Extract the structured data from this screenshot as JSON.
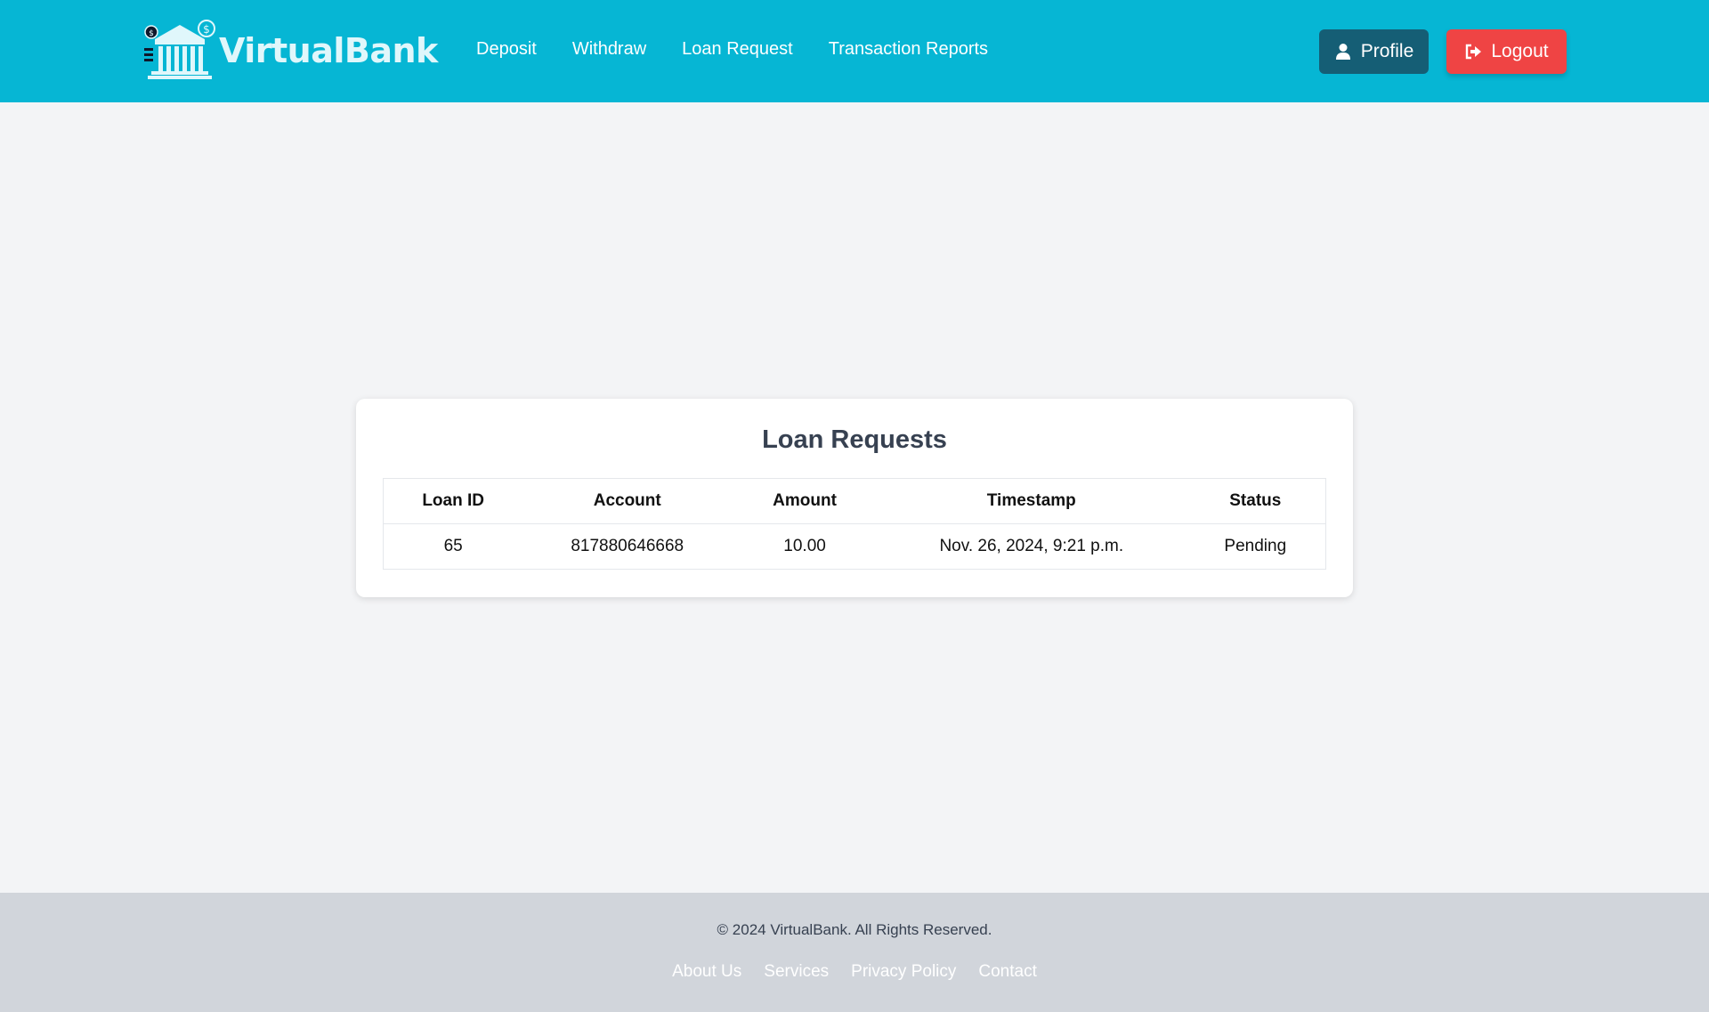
{
  "brand": {
    "name": "VirtualBank",
    "colors": {
      "header": "#06b6d4",
      "profile": "#155e75",
      "logout": "#ef4444"
    }
  },
  "nav": [
    {
      "label": "Deposit"
    },
    {
      "label": "Withdraw"
    },
    {
      "label": "Loan Request"
    },
    {
      "label": "Transaction Reports"
    }
  ],
  "actions": {
    "profile": {
      "label": "Profile",
      "icon": "user-icon"
    },
    "logout": {
      "label": "Logout",
      "icon": "sign-out-icon"
    }
  },
  "main": {
    "title": "Loan Requests",
    "columns": [
      "Loan ID",
      "Account",
      "Amount",
      "Timestamp",
      "Status"
    ],
    "rows": [
      [
        "65",
        "817880646668",
        "10.00",
        "Nov. 26, 2024, 9:21 p.m.",
        "Pending"
      ]
    ]
  },
  "footer": {
    "copyright": "© 2024 VirtualBank. All Rights Reserved.",
    "links": [
      "About Us",
      "Services",
      "Privacy Policy",
      "Contact"
    ]
  }
}
